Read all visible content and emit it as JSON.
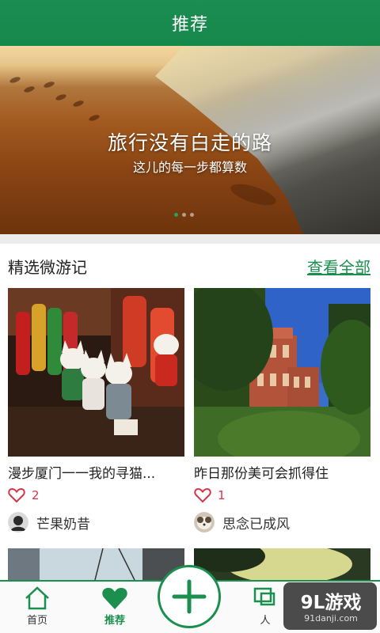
{
  "header": {
    "title": "推荐"
  },
  "banner": {
    "line1": "旅行没有白走的路",
    "line2": "这儿的每一步都算数",
    "slide_count": 3,
    "active_slide": 1
  },
  "section": {
    "title": "精选微游记",
    "see_all": "查看全部"
  },
  "cards": [
    {
      "title": "漫步厦门一一我的寻猫...",
      "likes": "2",
      "author": "芒果奶昔"
    },
    {
      "title": "昨日那份美可会抓得住",
      "likes": "1",
      "author": "思念已成风"
    }
  ],
  "nav": {
    "home": "首页",
    "recommend": "推荐",
    "people": "人",
    "add_icon": "plus-icon"
  },
  "watermark": {
    "logo": "9L游戏",
    "url": "91danji.com"
  },
  "colors": {
    "accent": "#1b8f4e",
    "like": "#d9334a"
  }
}
